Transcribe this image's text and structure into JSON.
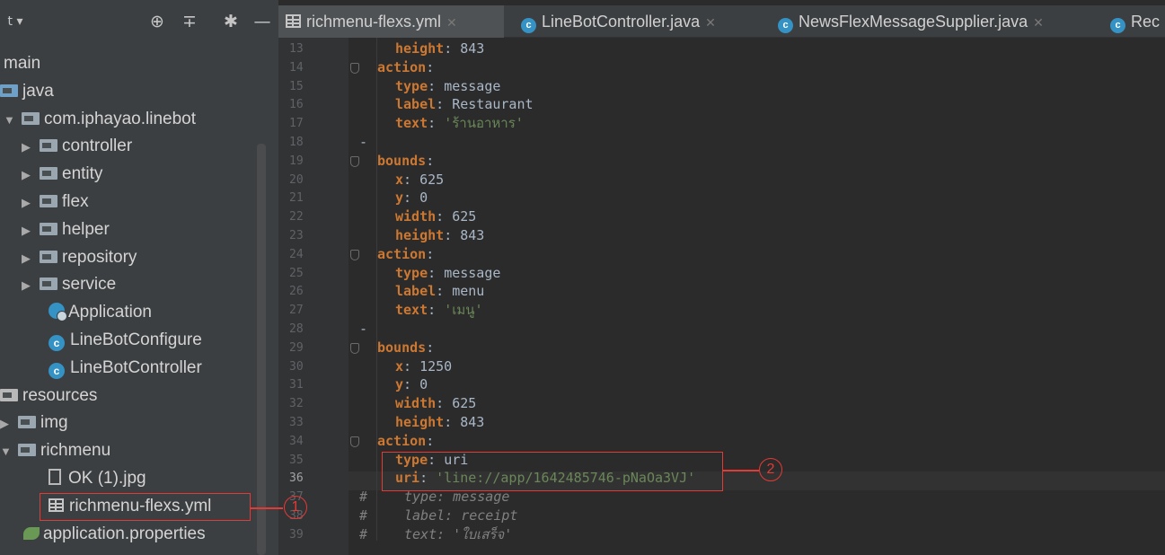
{
  "project_panel": {
    "tree": [
      {
        "label": "main",
        "kind": "text",
        "expanded": true
      },
      {
        "label": "java",
        "kind": "folder-blue"
      },
      {
        "label": "com.iphayao.linebot",
        "kind": "package",
        "expanded": true
      },
      {
        "label": "controller",
        "kind": "package",
        "expanded": false
      },
      {
        "label": "entity",
        "kind": "package",
        "expanded": false
      },
      {
        "label": "flex",
        "kind": "package",
        "expanded": false
      },
      {
        "label": "helper",
        "kind": "package",
        "expanded": false
      },
      {
        "label": "repository",
        "kind": "package",
        "expanded": false
      },
      {
        "label": "service",
        "kind": "package",
        "expanded": false
      },
      {
        "label": "Application",
        "kind": "spring-class"
      },
      {
        "label": "LineBotConfigure",
        "kind": "class"
      },
      {
        "label": "LineBotController",
        "kind": "class"
      },
      {
        "label": "resources",
        "kind": "resources-folder"
      },
      {
        "label": "img",
        "kind": "folder",
        "expanded": false
      },
      {
        "label": "richmenu",
        "kind": "folder",
        "expanded": true
      },
      {
        "label": "OK (1).jpg",
        "kind": "image-file"
      },
      {
        "label": "richmenu-flexs.yml",
        "kind": "yaml-file"
      },
      {
        "label": "application.properties",
        "kind": "properties-file"
      }
    ]
  },
  "tabs": [
    {
      "label": "richmenu-flexs.yml",
      "icon": "table-icon",
      "active": true
    },
    {
      "label": "LineBotController.java",
      "icon": "java-class-icon",
      "active": false
    },
    {
      "label": "NewsFlexMessageSupplier.java",
      "icon": "java-class-icon",
      "active": false
    },
    {
      "label": "Rec",
      "icon": "java-class-icon",
      "active": false
    }
  ],
  "editor": {
    "current_line": "36",
    "lines": [
      {
        "n": "13",
        "key": "height",
        "val": "843",
        "type": "num",
        "indent": 2
      },
      {
        "n": "14",
        "key": "action",
        "val": "",
        "type": "none",
        "indent": 1
      },
      {
        "n": "15",
        "key": "type",
        "val": "message",
        "type": "num",
        "indent": 2
      },
      {
        "n": "16",
        "key": "label",
        "val": "Restaurant",
        "type": "num",
        "indent": 2
      },
      {
        "n": "17",
        "key": "text",
        "val": "'ร้านอาหาร'",
        "type": "str",
        "indent": 2
      },
      {
        "n": "18",
        "key": "",
        "val": "",
        "type": "none",
        "indent": 0
      },
      {
        "n": "19",
        "key": "bounds",
        "val": "",
        "type": "none",
        "indent": 1
      },
      {
        "n": "20",
        "key": "x",
        "val": "625",
        "type": "num",
        "indent": 2
      },
      {
        "n": "21",
        "key": "y",
        "val": "0",
        "type": "num",
        "indent": 2
      },
      {
        "n": "22",
        "key": "width",
        "val": "625",
        "type": "num",
        "indent": 2
      },
      {
        "n": "23",
        "key": "height",
        "val": "843",
        "type": "num",
        "indent": 2
      },
      {
        "n": "24",
        "key": "action",
        "val": "",
        "type": "none",
        "indent": 1
      },
      {
        "n": "25",
        "key": "type",
        "val": "message",
        "type": "num",
        "indent": 2
      },
      {
        "n": "26",
        "key": "label",
        "val": "menu",
        "type": "num",
        "indent": 2
      },
      {
        "n": "27",
        "key": "text",
        "val": "'เมนู'",
        "type": "str",
        "indent": 2
      },
      {
        "n": "28",
        "key": "",
        "val": "",
        "type": "none",
        "indent": 0
      },
      {
        "n": "29",
        "key": "bounds",
        "val": "",
        "type": "none",
        "indent": 1
      },
      {
        "n": "30",
        "key": "x",
        "val": "1250",
        "type": "num",
        "indent": 2
      },
      {
        "n": "31",
        "key": "y",
        "val": "0",
        "type": "num",
        "indent": 2
      },
      {
        "n": "32",
        "key": "width",
        "val": "625",
        "type": "num",
        "indent": 2
      },
      {
        "n": "33",
        "key": "height",
        "val": "843",
        "type": "num",
        "indent": 2
      },
      {
        "n": "34",
        "key": "action",
        "val": "",
        "type": "none",
        "indent": 1
      },
      {
        "n": "35",
        "key": "type",
        "val": "uri",
        "type": "num",
        "indent": 2
      },
      {
        "n": "36",
        "key": "uri",
        "val": "'line://app/1642485746-pNaOa3VJ'",
        "type": "str",
        "indent": 2
      },
      {
        "n": "37",
        "key": "#",
        "val": "type: message",
        "type": "comment",
        "indent": 0
      },
      {
        "n": "38",
        "key": "#",
        "val": "label: receipt",
        "type": "comment",
        "indent": 0
      },
      {
        "n": "39",
        "key": "#",
        "val": "text: 'ใบเสร็จ'",
        "type": "comment",
        "indent": 0
      }
    ]
  },
  "annotations": {
    "badge_1": "1",
    "badge_2": "2",
    "color": "#e53935"
  }
}
